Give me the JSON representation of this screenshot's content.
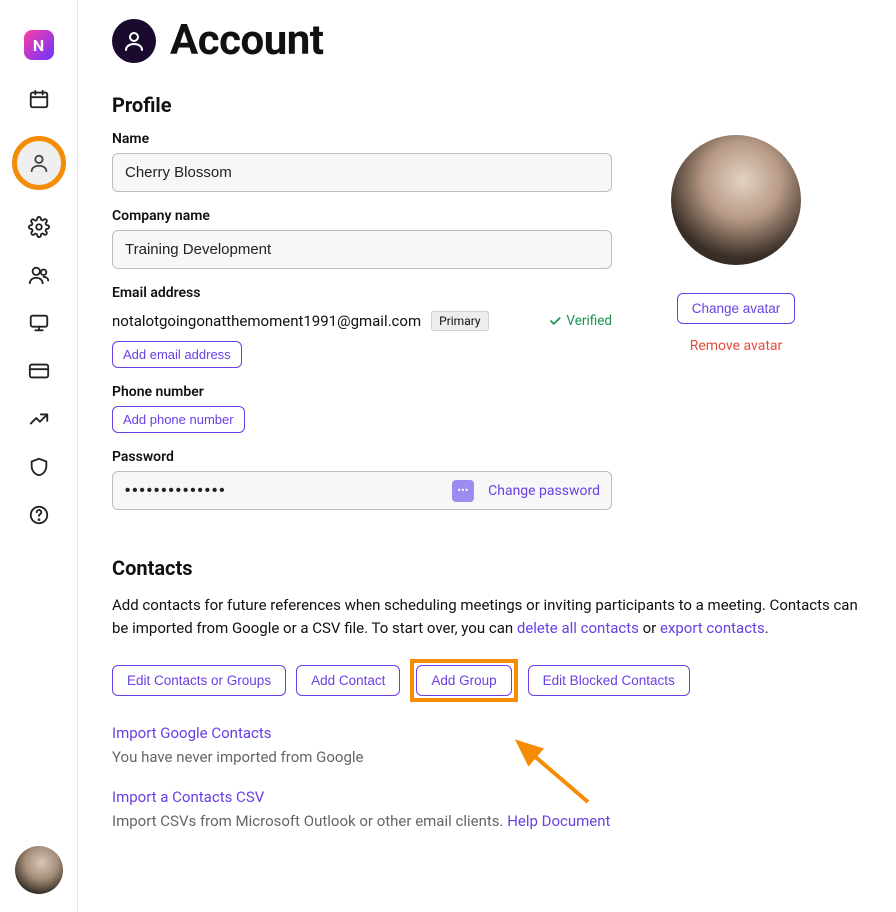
{
  "page": {
    "title": "Account"
  },
  "profile": {
    "section_title": "Profile",
    "name_label": "Name",
    "name_value": "Cherry Blossom",
    "company_label": "Company name",
    "company_value": "Training Development",
    "email_label": "Email address",
    "email_value": "notalotgoingonatthemoment1991@gmail.com",
    "email_primary_badge": "Primary",
    "email_verified": "Verified",
    "add_email_label": "Add email address",
    "phone_label": "Phone number",
    "add_phone_label": "Add phone number",
    "password_label": "Password",
    "password_masked": "••••••••••••••",
    "change_password_label": "Change password",
    "change_avatar_label": "Change avatar",
    "remove_avatar_label": "Remove avatar"
  },
  "contacts": {
    "section_title": "Contacts",
    "desc_part1": "Add contacts for future references when scheduling meetings or inviting participants to a meeting. Contacts can be imported from Google or a CSV file. To start over, you can ",
    "delete_all_link": "delete all contacts",
    "desc_or": " or ",
    "export_link": "export contacts",
    "desc_end": ".",
    "btn_edit": "Edit Contacts or Groups",
    "btn_add_contact": "Add Contact",
    "btn_add_group": "Add Group",
    "btn_edit_blocked": "Edit Blocked Contacts",
    "import_google_link": "Import Google Contacts",
    "import_google_desc": "You have never imported from Google",
    "import_csv_link": "Import a Contacts CSV",
    "import_csv_desc_part1": "Import CSVs from Microsoft Outlook or other email clients. ",
    "help_doc_link": "Help Document"
  }
}
